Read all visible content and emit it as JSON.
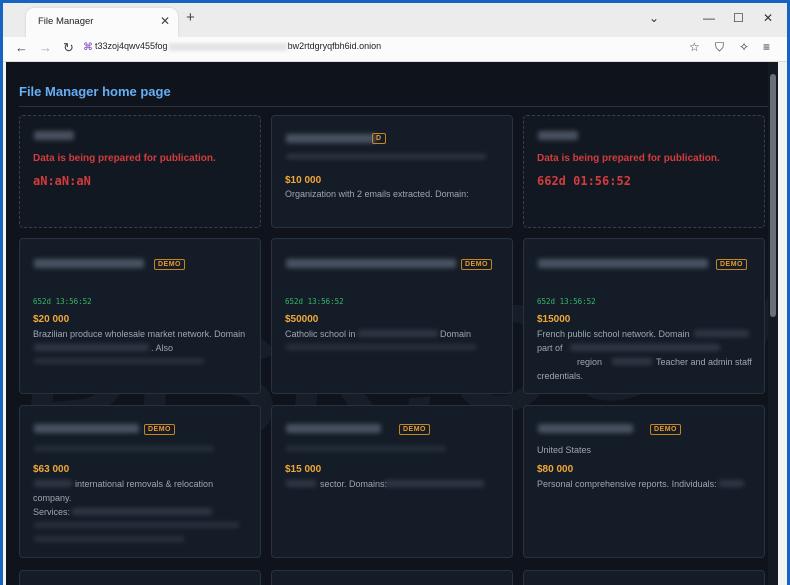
{
  "browser": {
    "tab_title": "File Manager",
    "url_start": "t33zoj4qwv455fog",
    "url_end": "bw2rtdgryqfbh6id.onion"
  },
  "page": {
    "heading": "File Manager home page"
  },
  "cards": [
    {
      "prep": "Data is being prepared for publication.",
      "countdown": "aN:aN:aN"
    },
    {
      "badge": "D",
      "price": "$10 000",
      "desc": "Organization with 2 emails extracted. Domain:"
    },
    {
      "prep": "Data is being prepared for publication.",
      "countdown": "662d 01:56:52"
    },
    {
      "badge": "DEMO",
      "timer": "652d 13:56:52",
      "price": "$20 000",
      "desc1": "Brazilian produce wholesale market network. Domain",
      "desc2": ". Also"
    },
    {
      "badge": "DEMO",
      "timer": "652d 13:56:52",
      "price": "$50000",
      "desc1": "Catholic school in",
      "desc2": "Domain"
    },
    {
      "badge": "DEMO",
      "timer": "652d 13:56:52",
      "price": "$15000",
      "desc1": "French public school network. Domain",
      "desc2": "part of",
      "desc3": "region",
      "desc4": "Teacher and admin staff",
      "desc5": "credentials."
    },
    {
      "badge": "DEMO",
      "price": "$63 000",
      "desc1": "international removals & relocation",
      "desc2": "company.",
      "desc3": "Services:"
    },
    {
      "badge": "DEMO",
      "price": "$15 000",
      "desc1": "sector. Domains:"
    },
    {
      "badge": "DEMO",
      "location": "United States",
      "price": "$80 000",
      "desc1": "Personal comprehensive reports. Individuals:"
    }
  ],
  "colors": {
    "accent": "#66aef5",
    "price": "#f0a83a",
    "alert": "#d33c3c",
    "timer": "#38b76a"
  }
}
